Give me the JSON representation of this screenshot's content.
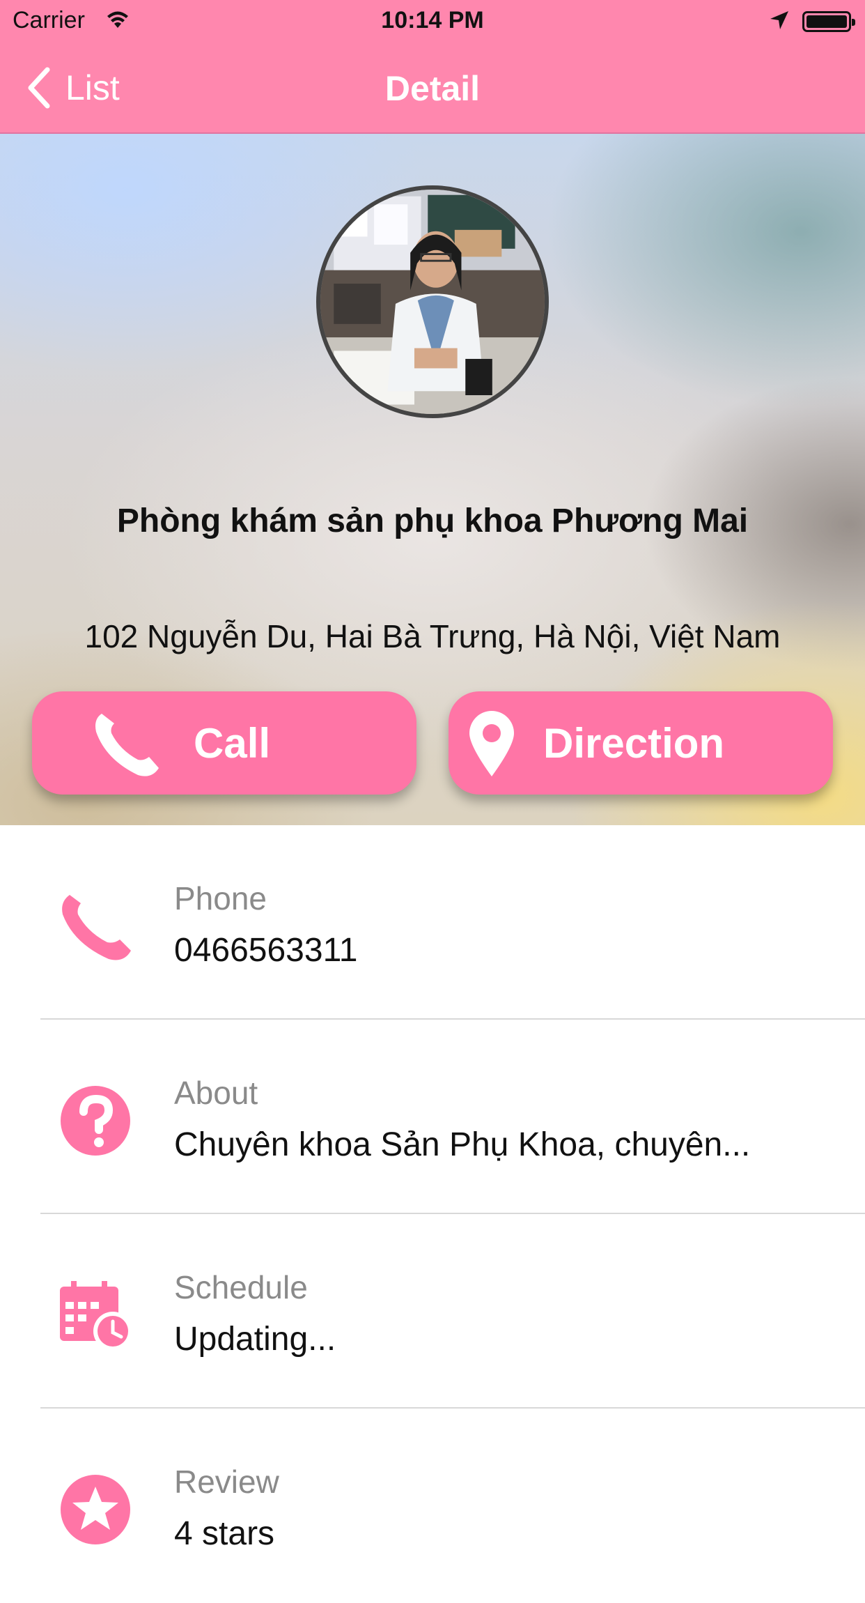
{
  "status_bar": {
    "carrier": "Carrier",
    "time": "10:14 PM",
    "wifi_icon": "wifi-icon",
    "location_icon": "location-arrow-icon",
    "battery_icon": "battery-icon"
  },
  "nav": {
    "back_label": "List",
    "title": "Detail",
    "color": "#ff87ae"
  },
  "clinic": {
    "name": "Phòng khám sản phụ khoa Phương Mai",
    "address": "102 Nguyễn Du, Hai Bà Trưng, Hà Nội, Việt Nam"
  },
  "actions": {
    "call_label": "Call",
    "direction_label": "Direction",
    "accent": "#ff75a6"
  },
  "details": [
    {
      "label": "Phone",
      "value": "0466563311",
      "icon": "phone-icon"
    },
    {
      "label": "About",
      "value": "Chuyên khoa Sản Phụ Khoa, chuyên...",
      "icon": "question-icon"
    },
    {
      "label": "Schedule",
      "value": "Updating...",
      "icon": "calendar-clock-icon"
    },
    {
      "label": "Review",
      "value": "4 stars",
      "icon": "star-icon"
    }
  ]
}
